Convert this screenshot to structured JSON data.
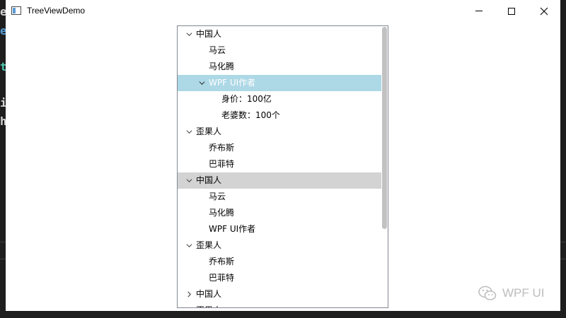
{
  "window": {
    "title": "TreeViewDemo",
    "controls": {
      "minimize": "minimize-icon",
      "maximize": "maximize-icon",
      "close": "close-icon"
    }
  },
  "background_editor_chars": [
    "e",
    "e",
    "t",
    "i",
    "h"
  ],
  "tree": {
    "rows": [
      {
        "text": "中国人",
        "expander": "expanded"
      },
      {
        "text": "马云",
        "expander": "none"
      },
      {
        "text": "马化腾",
        "expander": "none"
      },
      {
        "text": "WPF UI作者",
        "expander": "expanded",
        "state": "selected"
      },
      {
        "text": "身价：100亿",
        "expander": "none"
      },
      {
        "text": "老婆数：100个",
        "expander": "none"
      },
      {
        "text": "歪果人",
        "expander": "expanded"
      },
      {
        "text": "乔布斯",
        "expander": "none"
      },
      {
        "text": "巴菲特",
        "expander": "none"
      },
      {
        "text": "中国人",
        "expander": "expanded",
        "state": "hover"
      },
      {
        "text": "马云",
        "expander": "none"
      },
      {
        "text": "马化腾",
        "expander": "none"
      },
      {
        "text": "WPF UI作者",
        "expander": "none"
      },
      {
        "text": "歪果人",
        "expander": "expanded"
      },
      {
        "text": "乔布斯",
        "expander": "none"
      },
      {
        "text": "巴菲特",
        "expander": "none"
      },
      {
        "text": "中国人",
        "expander": "collapsed"
      },
      {
        "text": "歪果人",
        "expander": "none"
      }
    ],
    "selected_color": "#add8e6",
    "hover_color": "#d3d3d3"
  },
  "watermark": {
    "text": "WPF UI",
    "icon": "wechat-icon"
  }
}
